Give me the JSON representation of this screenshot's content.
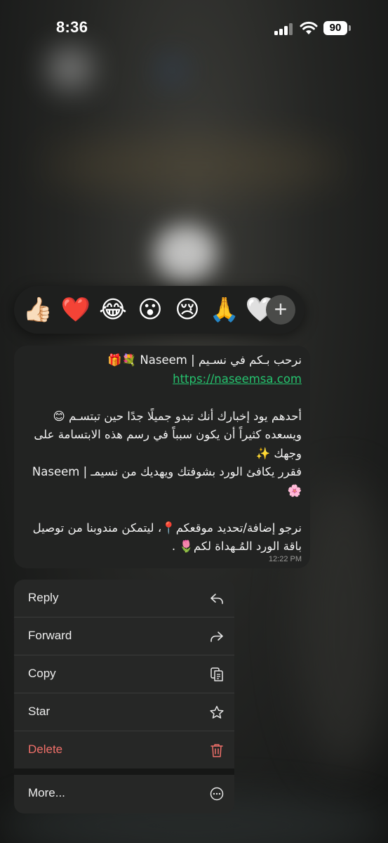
{
  "status_bar": {
    "time": "8:36",
    "battery": "90"
  },
  "reactions": {
    "items": [
      {
        "emoji": "👍🏻",
        "name": "thumbs-up"
      },
      {
        "emoji": "❤️",
        "name": "red-heart"
      },
      {
        "emoji": "😂",
        "name": "tears-of-joy"
      },
      {
        "emoji": "😮",
        "name": "surprised"
      },
      {
        "emoji": "😢",
        "name": "crying"
      },
      {
        "emoji": "🙏",
        "name": "folded-hands"
      },
      {
        "emoji": "🤍",
        "name": "white-heart"
      }
    ],
    "more_symbol": "+"
  },
  "message": {
    "line1": "نرحب بـكم في نسـيم | Naseem 💐🎁",
    "link": "https://naseemsa.com",
    "para2": "أحدهم يود إخبارك أنك تبدو جميلًا جدًا حين تبتسـم 😊 ويسعده كثيراً أن يكون سبباً في رسم هذه الابتسامة على وجهك ✨",
    "para3": "فقرر يكافئ الورد بشوفتك ويهديك من نسيمـ | Naseem 🌸",
    "para4": "نرجو إضافة/تحديد موقعكم📍، ليتمكن مندوبنا من توصيل باقة الورد المُـهداة لكم🌷 .",
    "time": "12:22 PM"
  },
  "menu": {
    "reply": "Reply",
    "forward": "Forward",
    "copy": "Copy",
    "star": "Star",
    "delete": "Delete",
    "more": "More..."
  },
  "colors": {
    "link": "#25c26e",
    "danger": "#f0706a",
    "bubble": "#222322",
    "menu": "#262726"
  }
}
